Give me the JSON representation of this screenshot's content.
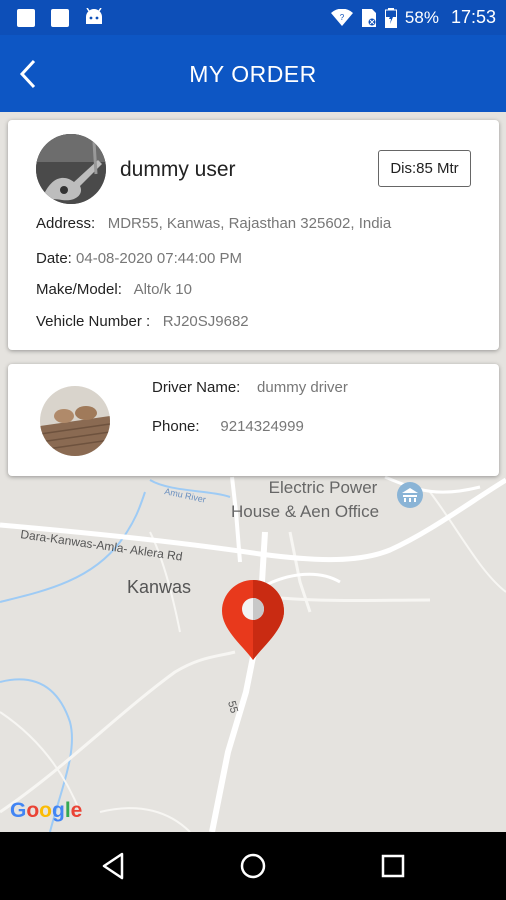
{
  "status_bar": {
    "battery": "58%",
    "time": "17:53",
    "icons": [
      "notification-square-icon",
      "notification-square-icon",
      "android-icon",
      "wifi-icon",
      "no-sim-icon",
      "battery-icon"
    ]
  },
  "header": {
    "title": "MY ORDER",
    "back_icon": "back-arrow-icon"
  },
  "customer": {
    "name": "dummy user",
    "distance": "Dis:85 Mtr",
    "address_label": "Address:",
    "address_value": "MDR55, Kanwas, Rajasthan 325602, India",
    "date_label": "Date:",
    "date_value": "04-08-2020 07:44:00 PM",
    "make_label": "Make/Model:",
    "make_value": "Alto/k 10",
    "vehicle_label": "Vehicle Number :",
    "vehicle_value": "RJ20SJ9682"
  },
  "driver": {
    "name_label": "Driver Name:",
    "name_value": "dummy driver",
    "phone_label": "Phone:",
    "phone_value": "9214324999"
  },
  "map": {
    "labels": {
      "power_office_1": "Electric Power",
      "power_office_2": "House & Aen Office",
      "road": "Dara-Kanwas-Amla- Aklera Rd",
      "river": "Amu River",
      "town": "Kanwas",
      "highway": "55",
      "logo": "Google"
    },
    "pin_color": "#e8391c",
    "road_color": "#ffffff",
    "water_color": "#9ecbf5"
  },
  "nav_bar": {
    "back": "nav-back-icon",
    "home": "nav-home-icon",
    "recents": "nav-recents-icon"
  },
  "colors": {
    "primary": "#0d56c4",
    "status_bar": "#0d4fb8"
  }
}
